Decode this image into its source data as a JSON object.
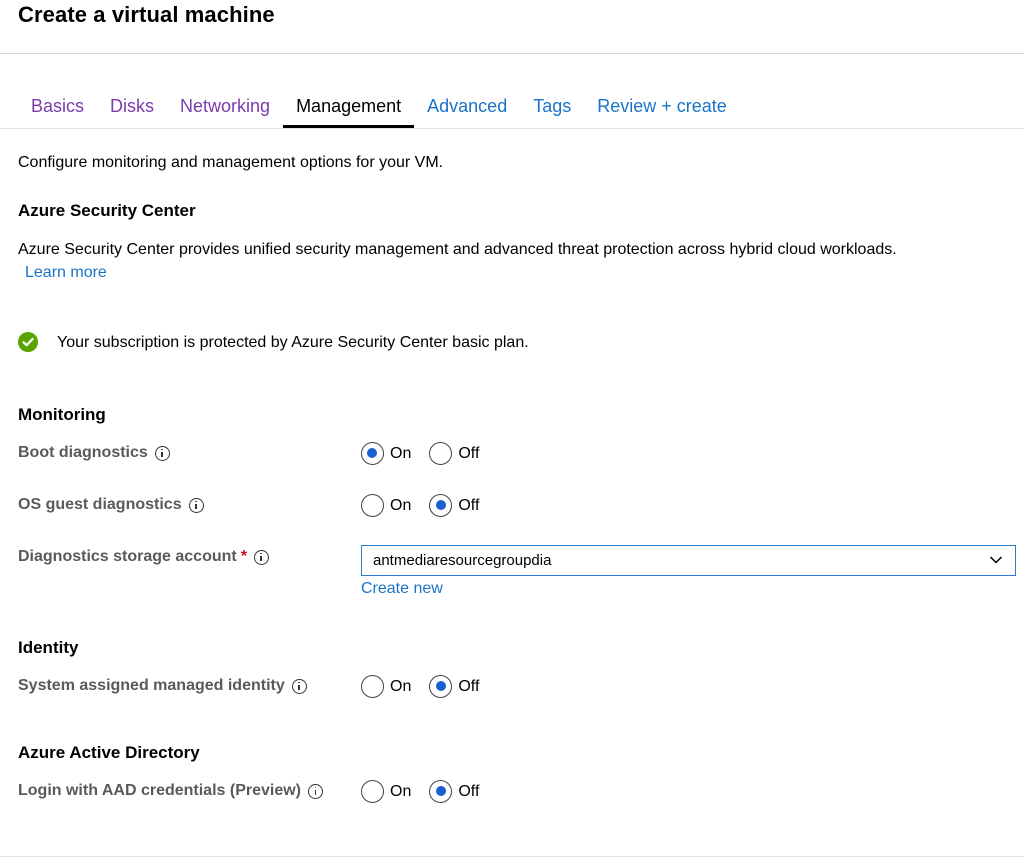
{
  "page": {
    "title": "Create a virtual machine"
  },
  "tabs": [
    {
      "label": "Basics",
      "state": "visited"
    },
    {
      "label": "Disks",
      "state": "visited"
    },
    {
      "label": "Networking",
      "state": "visited"
    },
    {
      "label": "Management",
      "state": "active"
    },
    {
      "label": "Advanced",
      "state": "link"
    },
    {
      "label": "Tags",
      "state": "link"
    },
    {
      "label": "Review + create",
      "state": "link"
    }
  ],
  "intro": "Configure monitoring and management options for your VM.",
  "security_center": {
    "title": "Azure Security Center",
    "description": "Azure Security Center provides unified security management and advanced threat protection across hybrid cloud workloads.",
    "learn_more": "Learn more",
    "status_message": "Your subscription is protected by Azure Security Center basic plan.",
    "status_icon": "check-circle-icon",
    "status_color": "#57a300"
  },
  "monitoring": {
    "title": "Monitoring",
    "boot_diagnostics": {
      "label": "Boot diagnostics",
      "on_label": "On",
      "off_label": "Off",
      "selected": "On"
    },
    "os_guest_diagnostics": {
      "label": "OS guest diagnostics",
      "on_label": "On",
      "off_label": "Off",
      "selected": "Off"
    },
    "storage_account": {
      "label": "Diagnostics storage account",
      "required_mark": "*",
      "value": "antmediaresourcegroupdia",
      "create_new": "Create new"
    }
  },
  "identity": {
    "title": "Identity",
    "system_assigned": {
      "label": "System assigned managed identity",
      "on_label": "On",
      "off_label": "Off",
      "selected": "Off"
    }
  },
  "aad": {
    "title": "Azure Active Directory",
    "login_aad": {
      "label": "Login with AAD credentials (Preview)",
      "on_label": "On",
      "off_label": "Off",
      "selected": "Off"
    }
  },
  "colors": {
    "visited_tab": "#7b3bad",
    "link": "#1a73c8",
    "radio_selected": "#1a5fd0",
    "required": "#c50f1f"
  }
}
